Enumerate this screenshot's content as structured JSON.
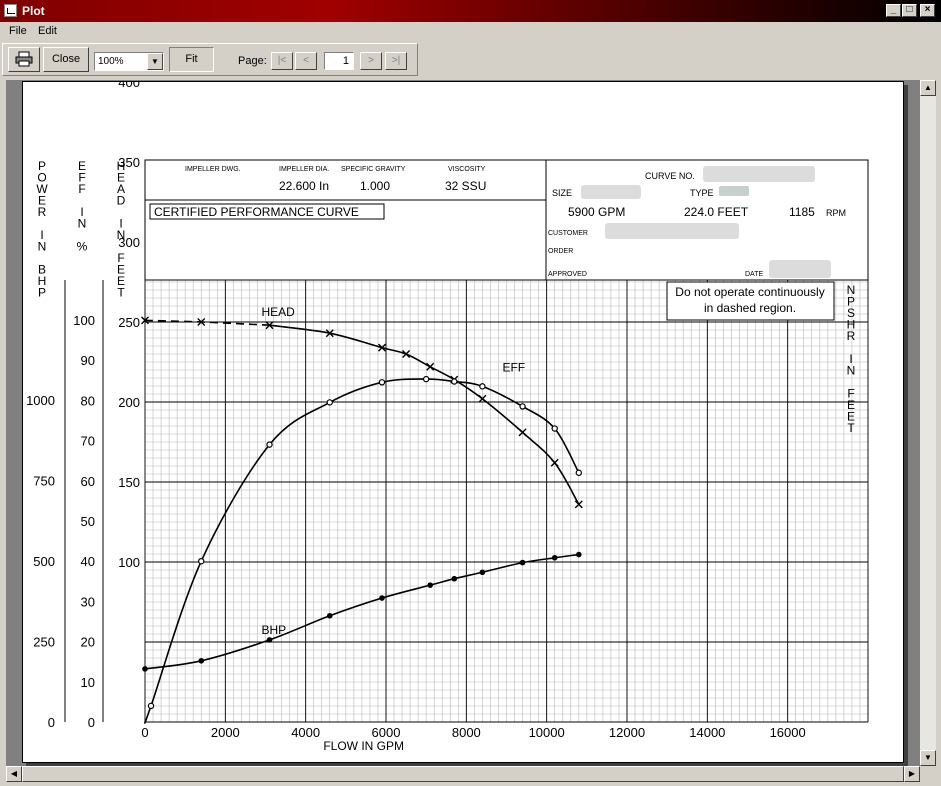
{
  "window": {
    "title": "Plot"
  },
  "menu": [
    "File",
    "Edit"
  ],
  "toolbar": {
    "close_label": "Close",
    "zoom_value": "100%",
    "fit_label": "Fit",
    "page_label": "Page:",
    "page_value": "1",
    "nav": [
      "|<",
      "<",
      ">",
      ">|"
    ]
  },
  "plot": {
    "axis_titles": {
      "power": [
        "P",
        "O",
        "W",
        "E",
        "R",
        "",
        "I",
        "N",
        "",
        "B",
        "H",
        "P"
      ],
      "eff": [
        "E",
        "F",
        "F",
        "",
        "I",
        "N",
        "",
        "%"
      ],
      "head": [
        "H",
        "E",
        "A",
        "D",
        "",
        "I",
        "N",
        "",
        "F",
        "E",
        "E",
        "T"
      ],
      "npshr": [
        "N",
        "P",
        "S",
        "H",
        "R",
        "",
        "I",
        "N",
        "",
        "F",
        "E",
        "E",
        "T"
      ]
    },
    "header": {
      "impeller_dwg_label": "IMPELLER DWG.",
      "impeller_dia_label": "IMPELLER DIA.",
      "impeller_dia_value": "22.600 In",
      "specific_gravity_label": "SPECIFIC GRAVITY",
      "specific_gravity_value": "1.000",
      "viscosity_label": "VISCOSITY",
      "viscosity_value": "32 SSU",
      "certified": "CERTIFIED PERFORMANCE CURVE",
      "curve_no_label": "CURVE NO.",
      "size_label": "SIZE",
      "type_label": "TYPE",
      "flow_value": "5900 GPM",
      "head_value": "224.0 FEET",
      "rpm_value": "1185",
      "rpm_label": "RPM",
      "customer_label": "CUSTOMER",
      "order_label": "ORDER",
      "approved_label": "APPROVED",
      "date_label": "DATE"
    },
    "note": [
      "Do not operate continuously",
      "in dashed region."
    ],
    "xlabel": "FLOW IN GPM",
    "series_labels": {
      "eff": "EFF",
      "head": "HEAD",
      "bhp": "BHP"
    }
  },
  "chart_data": {
    "type": "line",
    "xlabel": "FLOW IN GPM",
    "xlim": [
      0,
      18000
    ],
    "x_ticks": [
      0,
      2000,
      4000,
      6000,
      8000,
      10000,
      12000,
      14000,
      16000
    ],
    "head_axis": {
      "label": "HEAD IN FEET",
      "ticks": [
        100,
        150,
        200,
        250,
        300,
        350,
        400
      ]
    },
    "eff_axis": {
      "label": "EFF IN %",
      "ticks": [
        0,
        10,
        20,
        30,
        40,
        50,
        60,
        70,
        80,
        90,
        100
      ]
    },
    "power_axis": {
      "label": "POWER IN BHP",
      "ticks": [
        0,
        250,
        500,
        750,
        1000
      ]
    },
    "npshr_axis": {
      "label": "NPSHR IN FEET"
    },
    "series": [
      {
        "name": "HEAD",
        "unit": "ft",
        "dashed_to": 3100,
        "x": [
          0,
          1400,
          3100,
          4600,
          5900,
          6500,
          7100,
          7700,
          8400,
          9400,
          10200,
          10800
        ],
        "y": [
          251,
          250,
          248,
          243,
          234,
          230,
          222,
          214,
          202,
          181,
          162,
          136
        ]
      },
      {
        "name": "EFF",
        "unit": "%",
        "x": [
          0,
          150,
          1400,
          3100,
          4600,
          5900,
          7000,
          7700,
          8400,
          9400,
          10200,
          10800
        ],
        "y": [
          0,
          4,
          40,
          69,
          79.5,
          84.5,
          85.3,
          84.7,
          83.5,
          78.5,
          73,
          62
        ]
      },
      {
        "name": "BHP",
        "unit": "hp",
        "x": [
          0,
          1400,
          3100,
          4600,
          5900,
          7100,
          7700,
          8400,
          9400,
          10200,
          10800
        ],
        "y": [
          165,
          190,
          255,
          330,
          385,
          425,
          445,
          465,
          495,
          510,
          520
        ]
      }
    ]
  }
}
